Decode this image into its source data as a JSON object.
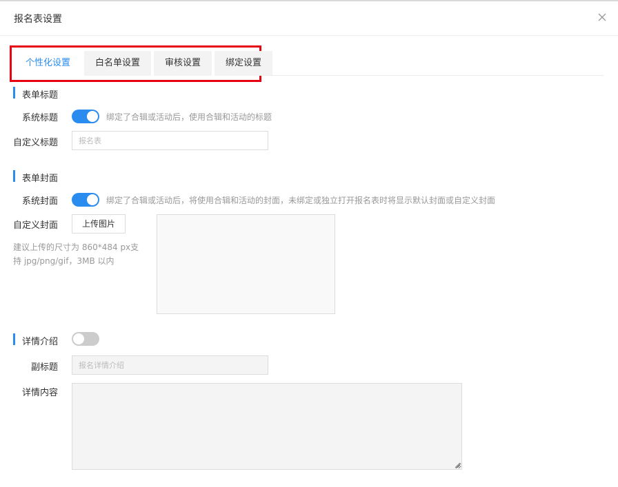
{
  "dialog": {
    "title": "报名表设置"
  },
  "tabs": [
    {
      "label": "个性化设置",
      "active": true
    },
    {
      "label": "白名单设置",
      "active": false
    },
    {
      "label": "审核设置",
      "active": false
    },
    {
      "label": "绑定设置",
      "active": false
    }
  ],
  "form_title_section": {
    "heading": "表单标题",
    "system_title_label": "系统标题",
    "system_title_enabled": true,
    "system_title_hint": "绑定了合辑或活动后，使用合辑和活动的标题",
    "custom_title_label": "自定义标题",
    "custom_title_value": "",
    "custom_title_placeholder": "报名表"
  },
  "form_cover_section": {
    "heading": "表单封面",
    "system_cover_label": "系统封面",
    "system_cover_enabled": true,
    "system_cover_hint": "绑定了合辑或活动后，将使用合辑和活动的封面，未绑定或独立打开报名表时将显示默认封面或自定义封面",
    "custom_cover_label": "自定义封面",
    "upload_button_label": "上传图片",
    "upload_hint_line1": "建议上传的尺寸为 860*484 px支",
    "upload_hint_line2": "持 jpg/png/gif，3MB 以内"
  },
  "details_section": {
    "heading": "详情介绍",
    "enabled": false,
    "subtitle_label": "副标题",
    "subtitle_value": "",
    "subtitle_placeholder": "报名详情介绍",
    "content_label": "详情内容",
    "content_value": ""
  },
  "colors": {
    "accent": "#2a8cee",
    "highlight_border": "#e60012",
    "toggle_off": "#cccccc"
  }
}
